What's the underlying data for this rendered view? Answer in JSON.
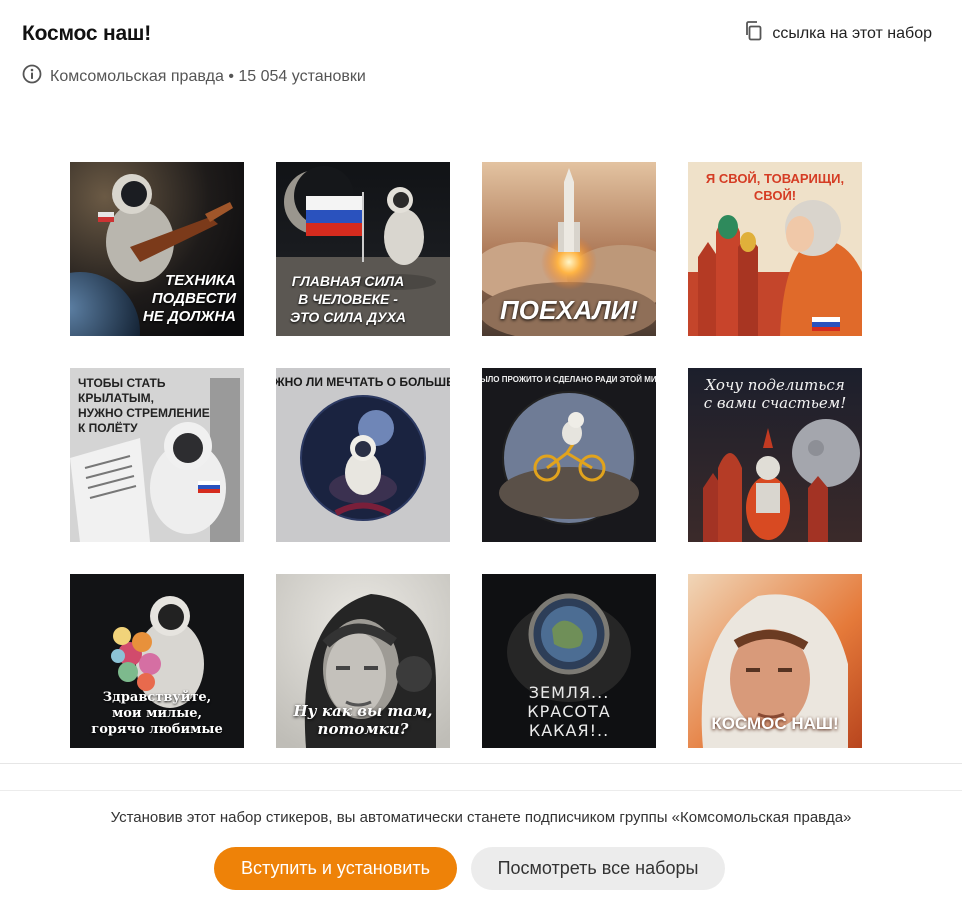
{
  "header": {
    "title": "Космос наш!",
    "share_label": "ссылка на этот набор",
    "meta": "Комсомольская правда • 15 054 установки"
  },
  "stickers": [
    {
      "caption": [
        "ТЕХНИКА",
        "ПОДВЕСТИ",
        "НЕ ДОЛЖНА"
      ]
    },
    {
      "caption": [
        "ГЛАВНАЯ СИЛА",
        "В ЧЕЛОВЕКЕ -",
        "ЭТО СИЛА ДУХА"
      ]
    },
    {
      "caption": [
        "ПОЕХАЛИ!"
      ]
    },
    {
      "caption": [
        "Я СВОЙ, ТОВАРИЩИ,",
        "СВОЙ!"
      ]
    },
    {
      "caption": [
        "ЧТОБЫ СТАТЬ КРЫЛАТЫМ,",
        "НУЖНО СТРЕМЛЕНИЕ",
        "К ПОЛЁТУ"
      ]
    },
    {
      "caption": [
        "МОЖНО ЛИ МЕЧТАТЬ О БОЛЬШЕМ?"
      ]
    },
    {
      "caption": [
        "ВСЁ БЫЛО ПРОЖИТО И СДЕЛАНО РАДИ ЭТОЙ МИНУТЫ!"
      ]
    },
    {
      "caption": [
        "Хочу поделиться",
        "с вами счастьем!"
      ]
    },
    {
      "caption": [
        "Здравствуйте,",
        "мои милые,",
        "горячо любимые"
      ]
    },
    {
      "caption": [
        "Ну как вы там,",
        "потомки?"
      ]
    },
    {
      "caption": [
        "ЗЕМЛЯ...",
        "КРАСОТА",
        "КАКАЯ!.."
      ]
    },
    {
      "caption": [
        "КОСМОС НАШ!"
      ]
    }
  ],
  "footer": {
    "notice": "Установив этот набор стикеров, вы автоматически станете подписчиком группы «Комсомольская правда»",
    "join_button": "Вступить и установить",
    "all_sets_button": "Посмотреть все наборы"
  },
  "colors": {
    "primary_button": "#ee8208",
    "secondary_button": "#ececec"
  },
  "icons": {
    "share": "copy-link-icon",
    "info": "info-icon"
  }
}
